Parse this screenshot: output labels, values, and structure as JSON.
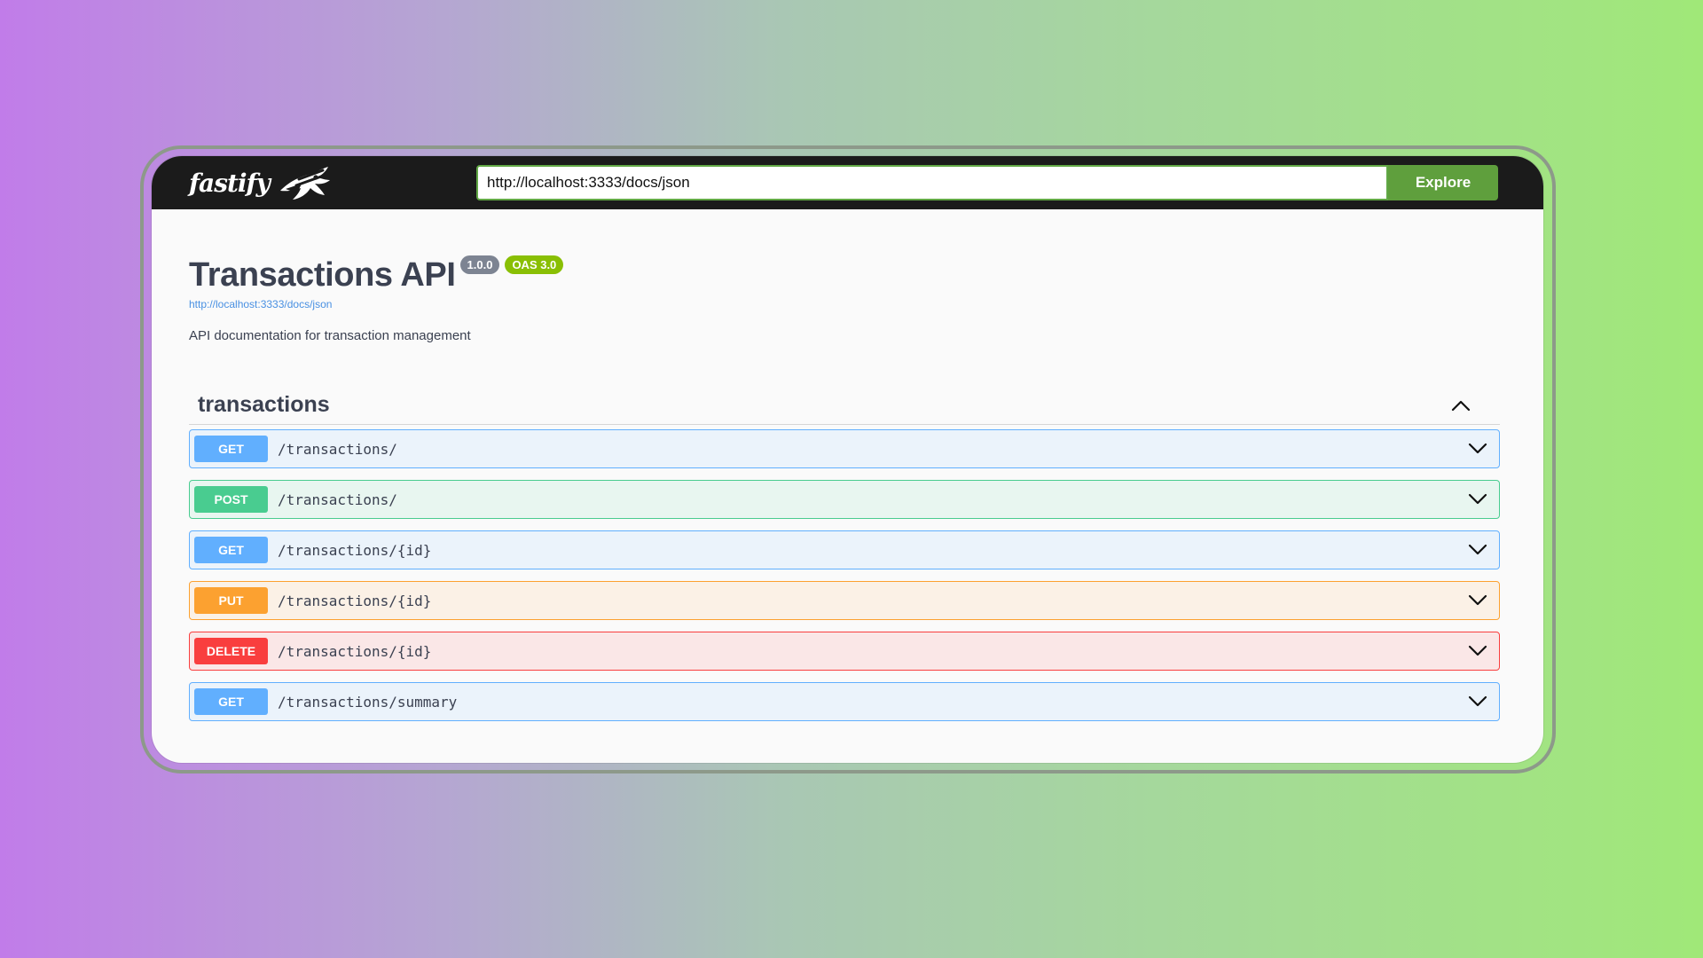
{
  "header": {
    "brand": "fastify",
    "url_value": "http://localhost:3333/docs/json",
    "explore_label": "Explore"
  },
  "api": {
    "title": "Transactions API",
    "version": "1.0.0",
    "oas_version": "OAS 3.0",
    "spec_url": "http://localhost:3333/docs/json",
    "description": "API documentation for transaction management"
  },
  "section": {
    "title": "transactions",
    "toggle_icon": "chevron-up-icon"
  },
  "endpoints": [
    {
      "method": "GET",
      "path": "/transactions/",
      "color": "#61affe",
      "icon": "chevron-down-icon"
    },
    {
      "method": "POST",
      "path": "/transactions/",
      "color": "#49cc90",
      "icon": "chevron-down-icon"
    },
    {
      "method": "GET",
      "path": "/transactions/{id}",
      "color": "#61affe",
      "icon": "chevron-down-icon"
    },
    {
      "method": "PUT",
      "path": "/transactions/{id}",
      "color": "#fca130",
      "icon": "chevron-down-icon"
    },
    {
      "method": "DELETE",
      "path": "/transactions/{id}",
      "color": "#f93e3e",
      "icon": "chevron-down-icon"
    },
    {
      "method": "GET",
      "path": "/transactions/summary",
      "color": "#61affe",
      "icon": "chevron-down-icon"
    }
  ],
  "colors": {
    "topbar": "#1b1b1b",
    "accent_green": "#5f9f3d",
    "get": "#61affe",
    "post": "#49cc90",
    "put": "#fca130",
    "delete": "#f93e3e",
    "oas_badge": "#89bf04",
    "version_badge": "#7d8492"
  }
}
